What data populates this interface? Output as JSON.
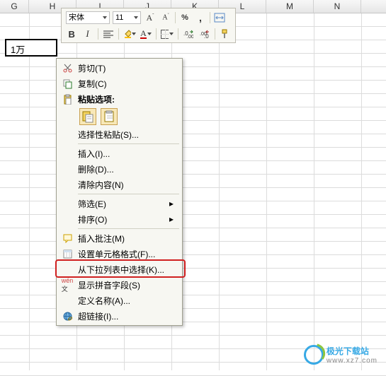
{
  "columns": [
    "G",
    "H",
    "I",
    "J",
    "K",
    "L",
    "M",
    "N"
  ],
  "selected_cell_value": "1万",
  "mini_toolbar": {
    "font_name": "宋体",
    "font_size": "11"
  },
  "context_menu": {
    "cut": "剪切(T)",
    "copy": "复制(C)",
    "paste_options": "粘贴选项:",
    "paste_special": "选择性粘贴(S)...",
    "insert": "插入(I)...",
    "delete": "删除(D)...",
    "clear": "清除内容(N)",
    "filter": "筛选(E)",
    "sort": "排序(O)",
    "insert_comment": "插入批注(M)",
    "format_cells": "设置单元格格式(F)...",
    "dropdown_pick": "从下拉列表中选择(K)...",
    "phonetic": "显示拼音字段(S)",
    "define_name": "定义名称(A)...",
    "hyperlink": "超链接(I)..."
  },
  "watermark": {
    "brand": "极光下载站",
    "url": "www.xz7.com"
  }
}
